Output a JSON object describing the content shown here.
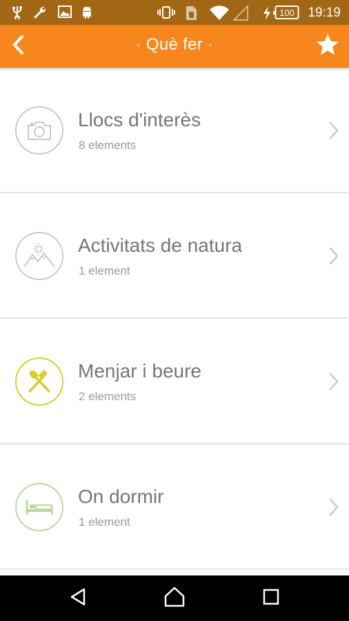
{
  "status_bar": {
    "time": "19:19",
    "battery": "100",
    "icons": [
      "usb-icon",
      "wrench-icon",
      "image-icon",
      "android-icon",
      "vibrate-icon",
      "sim-icon",
      "wifi-icon",
      "signal-icon",
      "charging-icon",
      "battery-icon"
    ]
  },
  "app_bar": {
    "title": "· Què fer ·",
    "back_icon": "chevron-left-icon",
    "favorite_icon": "star-icon",
    "color": "#f7871c"
  },
  "list": {
    "items": [
      {
        "title": "Llocs d'interès",
        "subtitle": "8 elements",
        "icon": "camera-icon",
        "icon_color": "#c9c9c9"
      },
      {
        "title": "Activitats de natura",
        "subtitle": "1 element",
        "icon": "mountains-sun-icon",
        "icon_color": "#c9c9c9"
      },
      {
        "title": "Menjar i beure",
        "subtitle": "2 elements",
        "icon": "spoon-fork-icon",
        "icon_color": "#d7cf2a"
      },
      {
        "title": "On dormir",
        "subtitle": "1 element",
        "icon": "bed-icon",
        "icon_color": "#bfd8a0"
      }
    ]
  },
  "nav_bar": {
    "buttons": [
      "back-triangle-icon",
      "home-icon",
      "recents-icon"
    ]
  }
}
